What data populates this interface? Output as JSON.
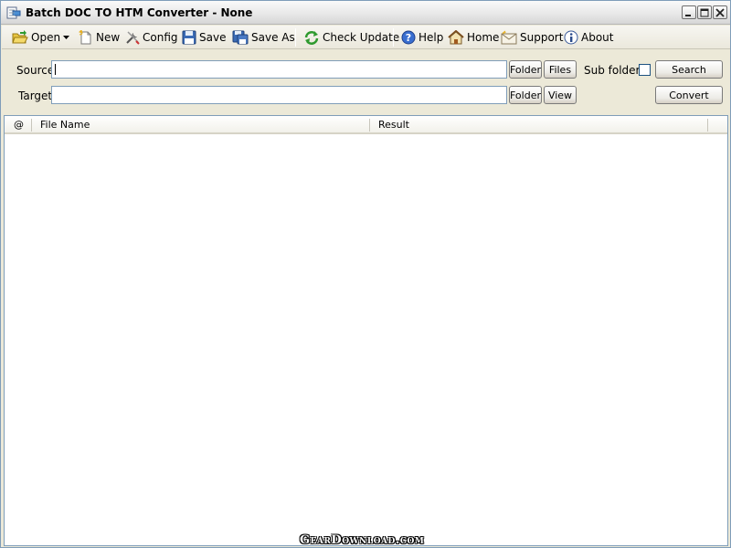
{
  "window": {
    "title": "Batch DOC TO HTM Converter - None"
  },
  "toolbar": {
    "open": "Open",
    "new": "New",
    "config": "Config",
    "save": "Save",
    "save_as": "Save As",
    "check_update": "Check Update",
    "help": "Help",
    "home": "Home",
    "support": "Support",
    "about": "About"
  },
  "form": {
    "source_label": "Source",
    "source_value": "",
    "target_label": "Target",
    "target_value": "",
    "folder_label": "Folder",
    "files_label": "Files",
    "view_label": "View",
    "sub_folders_label": "Sub folders",
    "sub_folders_checked": false,
    "search_label": "Search",
    "convert_label": "Convert"
  },
  "list": {
    "columns": [
      "@",
      "File Name",
      "Result"
    ],
    "rows": []
  },
  "watermark": "GearDownload.com",
  "colors": {
    "window_bg": "#ece9d8",
    "border": "#7f9db9"
  }
}
